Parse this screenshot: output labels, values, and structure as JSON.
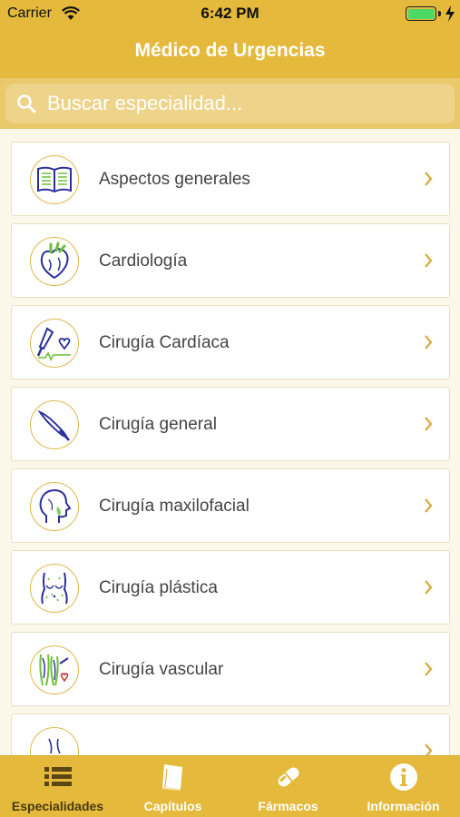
{
  "status_bar": {
    "carrier": "Carrier",
    "time": "6:42 PM"
  },
  "header": {
    "title": "Médico de Urgencias"
  },
  "search": {
    "placeholder": "Buscar especialidad..."
  },
  "specialties": [
    {
      "label": "Aspectos generales",
      "icon": "book-icon"
    },
    {
      "label": "Cardiología",
      "icon": "heart-anatomy-icon"
    },
    {
      "label": "Cirugía Cardíaca",
      "icon": "scalpel-heart-icon"
    },
    {
      "label": "Cirugía general",
      "icon": "scalpel-icon"
    },
    {
      "label": "Cirugía maxilofacial",
      "icon": "head-profile-icon"
    },
    {
      "label": "Cirugía plástica",
      "icon": "torso-icon"
    },
    {
      "label": "Cirugía vascular",
      "icon": "legs-veins-icon"
    }
  ],
  "tabs": [
    {
      "label": "Especialidades",
      "icon": "list-icon",
      "active": true
    },
    {
      "label": "Capítulos",
      "icon": "book-closed-icon",
      "active": false
    },
    {
      "label": "Fármacos",
      "icon": "pill-icon",
      "active": false
    },
    {
      "label": "Información",
      "icon": "info-icon",
      "active": false
    }
  ],
  "colors": {
    "accent": "#e4b93c",
    "icon_stroke": "#2c2f9a",
    "icon_accent": "#6dbf3a"
  }
}
